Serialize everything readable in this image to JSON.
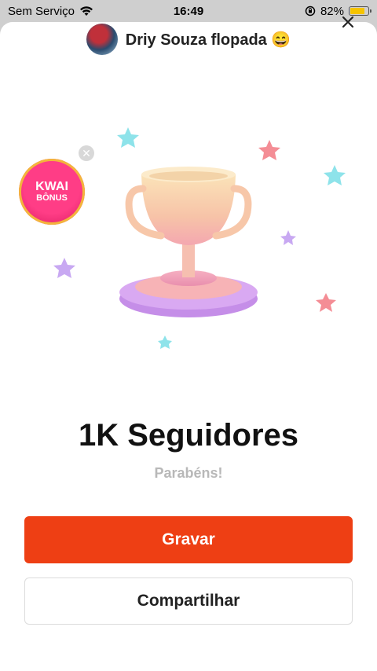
{
  "status_bar": {
    "carrier": "Sem Serviço",
    "time": "16:49",
    "battery": "82%",
    "battery_level": 0.82
  },
  "header": {
    "username": "Driy Souza flopada",
    "emoji": "😄"
  },
  "bonus": {
    "title": "KWAI",
    "subtitle": "BÔNUS"
  },
  "milestone": {
    "title": "1K Seguidores",
    "subtitle": "Parabéns!"
  },
  "buttons": {
    "record": "Gravar",
    "share": "Compartilhar"
  },
  "colors": {
    "accent": "#ee3f14",
    "sheet": "#ffffff"
  }
}
